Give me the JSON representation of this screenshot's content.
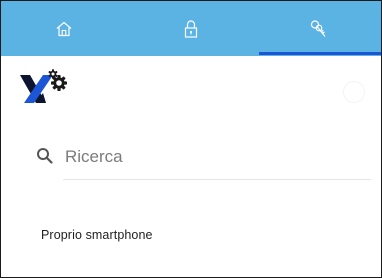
{
  "tabs": [
    {
      "icon": "home-icon",
      "active": false
    },
    {
      "icon": "lock-icon",
      "active": false
    },
    {
      "icon": "key-icon",
      "active": true
    }
  ],
  "colors": {
    "tab_bar": "#5bb3e4",
    "tab_indicator": "#1c55d6",
    "logo_blue": "#1c55d6",
    "logo_dark": "#0d1430"
  },
  "search": {
    "placeholder": "Ricerca",
    "value": ""
  },
  "section": {
    "label": "Proprio smartphone"
  }
}
